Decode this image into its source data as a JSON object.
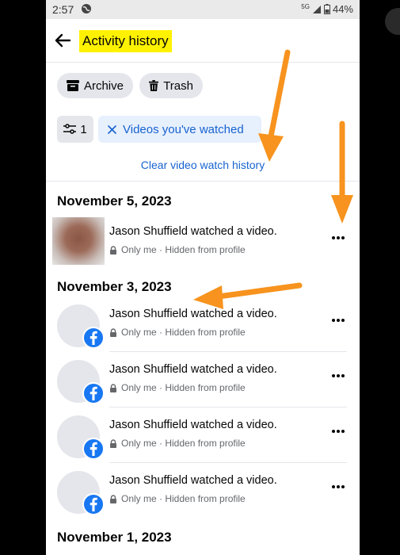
{
  "status": {
    "time": "2:57",
    "network": "5G",
    "battery": "44%"
  },
  "header": {
    "title": "Activity history"
  },
  "chips": {
    "archive": "Archive",
    "trash": "Trash"
  },
  "filters": {
    "count": "1",
    "active": "Videos you've watched"
  },
  "clear_link": "Clear video watch history",
  "groups": [
    {
      "date": "November 5, 2023",
      "items": [
        {
          "title": "Jason Shuffield watched a video.",
          "subtitle": "Only me · Hidden from profile"
        }
      ]
    },
    {
      "date": "November 3, 2023",
      "items": [
        {
          "title": "Jason Shuffield watched a video.",
          "subtitle": "Only me · Hidden from profile"
        },
        {
          "title": "Jason Shuffield watched a video.",
          "subtitle": "Only me · Hidden from profile"
        },
        {
          "title": "Jason Shuffield watched a video.",
          "subtitle": "Only me · Hidden from profile"
        },
        {
          "title": "Jason Shuffield watched a video.",
          "subtitle": "Only me · Hidden from profile"
        }
      ]
    },
    {
      "date": "November 1, 2023",
      "items": []
    }
  ],
  "colors": {
    "link_blue": "#1763cf",
    "highlight": "#fff200",
    "annotation_arrow": "#f7931e",
    "fb_blue": "#1877f2"
  },
  "icons": [
    "back-arrow-icon",
    "archive-icon",
    "trash-icon",
    "filter-sliders-icon",
    "close-x-icon",
    "lock-icon",
    "more-dots-icon",
    "facebook-icon",
    "globe-icon",
    "signal-icon",
    "battery-icon"
  ]
}
